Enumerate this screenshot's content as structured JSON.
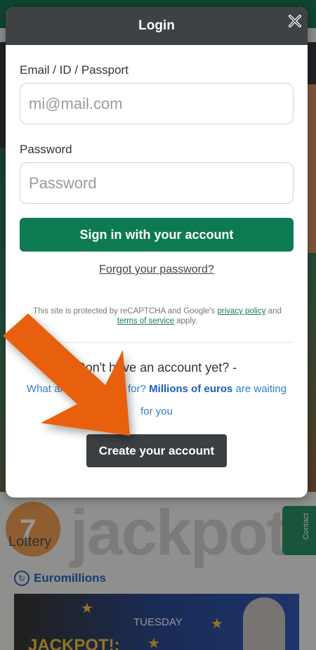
{
  "background": {
    "brand_text": "jackpots",
    "logo_number": "7",
    "lottery_label": "Lottery",
    "side_tab": "Contact",
    "section_label": "Euromillions",
    "banner": {
      "day": "TUESDAY",
      "headline": "JACKPOT!:"
    }
  },
  "modal": {
    "title": "Login",
    "email": {
      "label": "Email / ID / Passport",
      "placeholder": "mi@mail.com"
    },
    "password": {
      "label": "Password",
      "placeholder": "Password"
    },
    "signin_label": "Sign in with your account",
    "forgot_label": "Forgot your password?",
    "recaptcha": {
      "text_1": "This site is protected by reCAPTCHA and Google's",
      "privacy_link": "privacy policy",
      "text_2": "and",
      "terms_link": "terms of service",
      "text_3": "apply."
    },
    "no_account": "Don't have an account yet? -",
    "promo": {
      "text_1": "What are you waiting for?",
      "highlight": "Millions of euros",
      "text_2": "are waiting for you"
    },
    "create_label": "Create your account"
  },
  "colors": {
    "primary_green": "#0d7a52",
    "header_dark": "#3e4244",
    "button_dark": "#3b3f41",
    "link_blue": "#2e7ec9",
    "arrow_orange": "#e8600f"
  },
  "icons": {
    "close": "close-icon",
    "euro": "euromillions-icon"
  }
}
